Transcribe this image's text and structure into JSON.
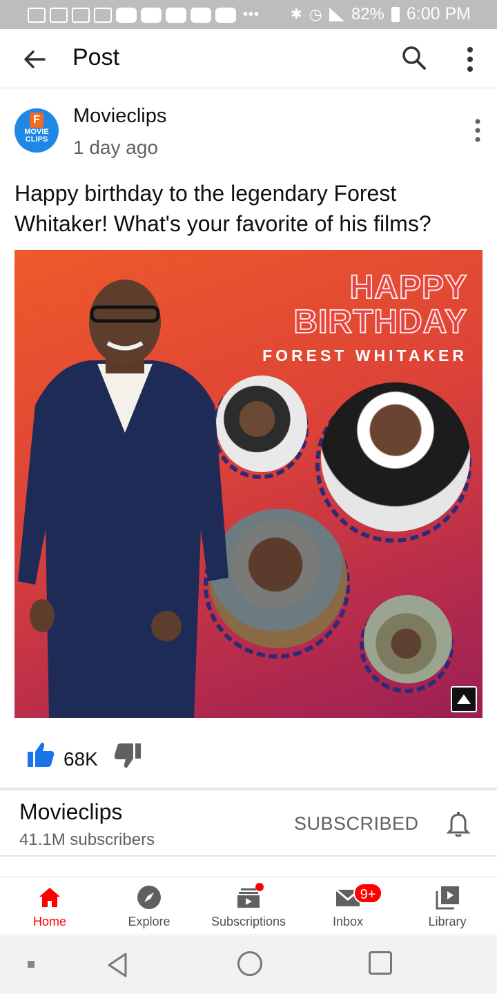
{
  "status_bar": {
    "battery": "82%",
    "time": "6:00 PM"
  },
  "app_bar": {
    "title": "Post"
  },
  "post": {
    "channel": "Movieclips",
    "time_ago": "1 day ago",
    "avatar_text_top": "F",
    "avatar_text": "MOVIE CLIPS",
    "text": "Happy birthday to the legendary Forest Whitaker! What's your favorite of his films?",
    "image": {
      "headline_1": "HAPPY",
      "headline_2": "BIRTHDAY",
      "name": "FOREST WHITAKER"
    },
    "likes": "68K"
  },
  "channel_card": {
    "name": "Movieclips",
    "subscribers": "41.1M subscribers",
    "subscribe_state": "SUBSCRIBED"
  },
  "bottom_nav": {
    "items": [
      {
        "label": "Home",
        "icon": "home-icon",
        "active": true
      },
      {
        "label": "Explore",
        "icon": "compass-icon"
      },
      {
        "label": "Subscriptions",
        "icon": "subscriptions-icon"
      },
      {
        "label": "Inbox",
        "icon": "mail-icon",
        "badge": "9+"
      },
      {
        "label": "Library",
        "icon": "library-icon"
      }
    ]
  },
  "colors": {
    "accent": "#ff0000",
    "like_blue": "#1a73e8",
    "status_bar": "#bdbdbd"
  }
}
